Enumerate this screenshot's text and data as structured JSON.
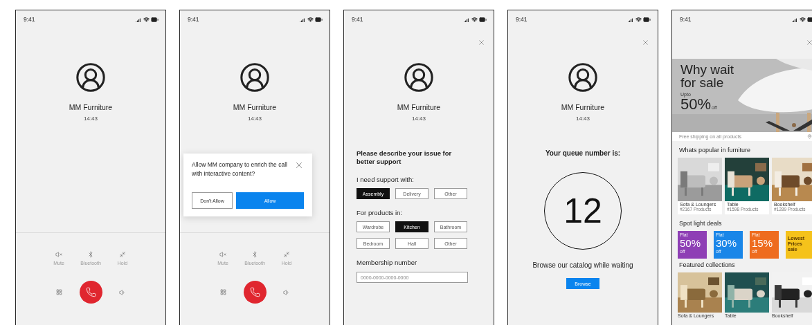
{
  "screens": [
    {
      "kind": "call",
      "status_time": "9:41",
      "closable": false,
      "caller": "MM Furniture",
      "duration": "14:43",
      "controls": [
        {
          "label": "Mute"
        },
        {
          "label": "Bluetooth"
        },
        {
          "label": "Hold"
        }
      ]
    },
    {
      "kind": "call",
      "status_time": "9:41",
      "closable": false,
      "caller": "MM Furniture",
      "duration": "14:43",
      "controls": [
        {
          "label": "Mute"
        },
        {
          "label": "Bluetooth"
        },
        {
          "label": "Hold"
        }
      ],
      "dialog": {
        "message": "Allow MM company to enrich the call with interactive content?",
        "buttons": [
          {
            "label": "Don't Allow",
            "primary": false
          },
          {
            "label": "Allow",
            "primary": true
          }
        ]
      }
    },
    {
      "kind": "form",
      "status_time": "9:41",
      "closable": true,
      "caller": "MM Furniture",
      "duration": "14:43",
      "title": "Please describe your issue for better support",
      "groups": [
        {
          "label": "I need support with:",
          "options": [
            {
              "label": "Assembly",
              "selected": true
            },
            {
              "label": "Delivery",
              "selected": false
            },
            {
              "label": "Other",
              "selected": false
            }
          ]
        },
        {
          "label": "For products in:",
          "options": [
            {
              "label": "Wardrobe",
              "selected": false
            },
            {
              "label": "Kitchen",
              "selected": true
            },
            {
              "label": "Bathroom",
              "selected": false
            },
            {
              "label": "Bedroom",
              "selected": false
            },
            {
              "label": "Hall",
              "selected": false
            },
            {
              "label": "Other",
              "selected": false
            }
          ]
        }
      ],
      "membership": {
        "label": "Membership number",
        "placeholder": "0000-0000-0000-0000"
      }
    },
    {
      "kind": "queue",
      "status_time": "9:41",
      "closable": true,
      "caller": "MM Furniture",
      "duration": "14:43",
      "prompt": "Your queue number is:",
      "number": "12",
      "hint": "Browse our catalog while waiting",
      "button": "Browse"
    },
    {
      "kind": "shop",
      "status_time": "9:41",
      "closable": true,
      "hero": {
        "headline": "Why wait for sale",
        "upto": "Upto",
        "discount": "50%",
        "off": "off"
      },
      "shipping": "Free shipping on all products",
      "popular": {
        "title": "Whats popular in furniture",
        "cards": [
          {
            "name": "Sofa & Loungers",
            "count": "#2167 Products"
          },
          {
            "name": "Table",
            "count": "#1598 Products"
          },
          {
            "name": "Bookshelf",
            "count": "#1289 Products"
          }
        ]
      },
      "deals": {
        "title": "Spot light deals",
        "tiles": [
          {
            "kind": "percent",
            "flat": "Flat",
            "value": "50%",
            "off": "off",
            "color": "#8e3fb5"
          },
          {
            "kind": "percent",
            "flat": "Flat",
            "value": "30%",
            "off": "off",
            "color": "#1a86e8"
          },
          {
            "kind": "percent",
            "flat": "Flat",
            "value": "15%",
            "off": "off",
            "color": "#ee6c1f"
          },
          {
            "kind": "text",
            "text": "Lowest Prices sale",
            "color": "#f5c21b"
          }
        ]
      },
      "featured": {
        "title": "Featured collections",
        "cards": [
          {
            "name": "Sofa & Loungers"
          },
          {
            "name": "Table"
          },
          {
            "name": "Bookshelf"
          }
        ]
      }
    }
  ]
}
